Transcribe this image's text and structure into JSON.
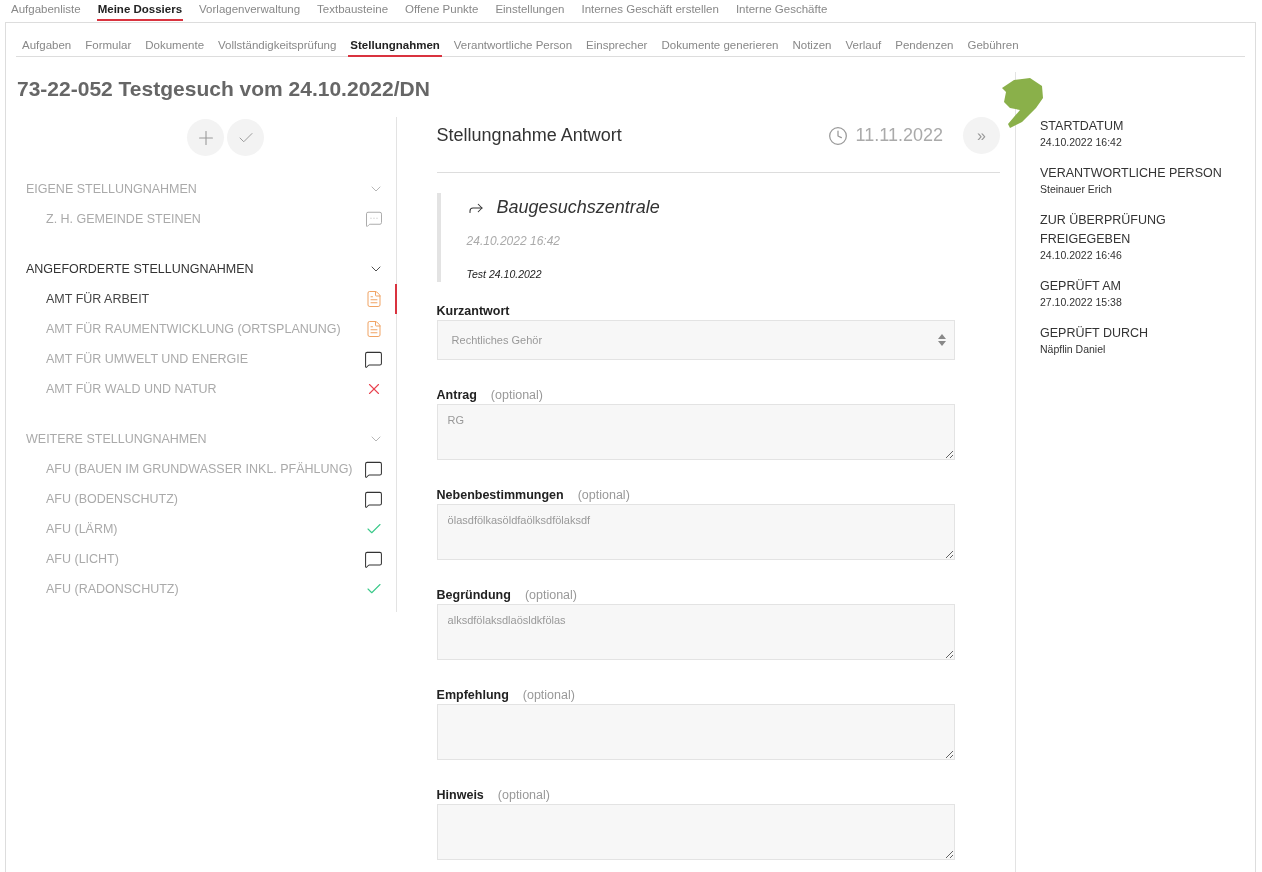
{
  "main_nav": [
    {
      "label": "Aufgabenliste",
      "selected": false
    },
    {
      "label": "Meine Dossiers",
      "selected": true
    },
    {
      "label": "Vorlagenverwaltung",
      "selected": false
    },
    {
      "label": "Textbausteine",
      "selected": false
    },
    {
      "label": "Offene Punkte",
      "selected": false
    },
    {
      "label": "Einstellungen",
      "selected": false
    },
    {
      "label": "Internes Geschäft erstellen",
      "selected": false
    },
    {
      "label": "Interne Geschäfte",
      "selected": false
    }
  ],
  "sub_nav": [
    {
      "label": "Aufgaben",
      "selected": false
    },
    {
      "label": "Formular",
      "selected": false
    },
    {
      "label": "Dokumente",
      "selected": false
    },
    {
      "label": "Vollständigkeitsprüfung",
      "selected": false
    },
    {
      "label": "Stellungnahmen",
      "selected": true
    },
    {
      "label": "Verantwortliche Person",
      "selected": false
    },
    {
      "label": "Einsprecher",
      "selected": false
    },
    {
      "label": "Dokumente generieren",
      "selected": false
    },
    {
      "label": "Notizen",
      "selected": false
    },
    {
      "label": "Verlauf",
      "selected": false
    },
    {
      "label": "Pendenzen",
      "selected": false
    },
    {
      "label": "Gebühren",
      "selected": false
    }
  ],
  "title": "73-22-052 Testgesuch vom 24.10.2022/DN",
  "groups": [
    {
      "heading": "EIGENE STELLUNGNAHMEN",
      "active": false,
      "items": [
        {
          "label": "Z. H. GEMEINDE STEINEN",
          "kind": "draft",
          "selected": false
        }
      ]
    },
    {
      "heading": "ANGEFORDERTE STELLUNGNAHMEN",
      "active": true,
      "items": [
        {
          "label": "AMT FÜR ARBEIT",
          "kind": "document",
          "selected": true
        },
        {
          "label": "AMT FÜR RAUMENTWICKLUNG (ORTSPLANUNG)",
          "kind": "document",
          "selected": false
        },
        {
          "label": "AMT FÜR UMWELT UND ENERGIE",
          "kind": "comment",
          "selected": false
        },
        {
          "label": "AMT FÜR WALD UND NATUR",
          "kind": "rejected",
          "selected": false
        }
      ]
    },
    {
      "heading": "WEITERE STELLUNGNAHMEN",
      "active": false,
      "items": [
        {
          "label": "AFU (BAUEN IM GRUNDWASSER INKL. PFÄHLUNG)",
          "kind": "comment",
          "selected": false
        },
        {
          "label": "AFU (BODENSCHUTZ)",
          "kind": "comment",
          "selected": false
        },
        {
          "label": "AFU (LÄRM)",
          "kind": "done",
          "selected": false
        },
        {
          "label": "AFU (LICHT)",
          "kind": "comment",
          "selected": false
        },
        {
          "label": "AFU (RADONSCHUTZ)",
          "kind": "done",
          "selected": false
        }
      ]
    }
  ],
  "answer": {
    "heading": "Stellungnahme Antwort",
    "due_date": "11.11.2022",
    "next_button": "»",
    "request": {
      "from": "Baugesuchszentrale",
      "date": "24.10.2022 16:42",
      "message": "Test 24.10.2022"
    },
    "short_answer": {
      "label": "Kurzantwort",
      "value": "Rechtliches Gehör"
    },
    "fields": [
      {
        "label": "Antrag",
        "hint": "(optional)",
        "value": "RG"
      },
      {
        "label": "Nebenbestimmungen",
        "hint": "(optional)",
        "value": "ölasdfölkasöldfaölksdfölaksdf"
      },
      {
        "label": "Begründung",
        "hint": "(optional)",
        "value": "alksdfölaksdlaösldkfölas"
      },
      {
        "label": "Empfehlung",
        "hint": "(optional)"
      },
      {
        "label": "Hinweis",
        "hint": "(optional)"
      }
    ]
  },
  "details": [
    {
      "label": "STARTDATUM",
      "value": "24.10.2022 16:42"
    },
    {
      "label": "VERANTWORTLICHE PERSON",
      "value": "Steinauer Erich"
    },
    {
      "label": "ZUR ÜBERPRÜFUNG FREIGEGEBEN",
      "value": "24.10.2022 16:46"
    },
    {
      "label": "GEPRÜFT AM",
      "value": "27.10.2022 15:38"
    },
    {
      "label": "GEPRÜFT DURCH",
      "value": "Näpflin Daniel"
    }
  ]
}
